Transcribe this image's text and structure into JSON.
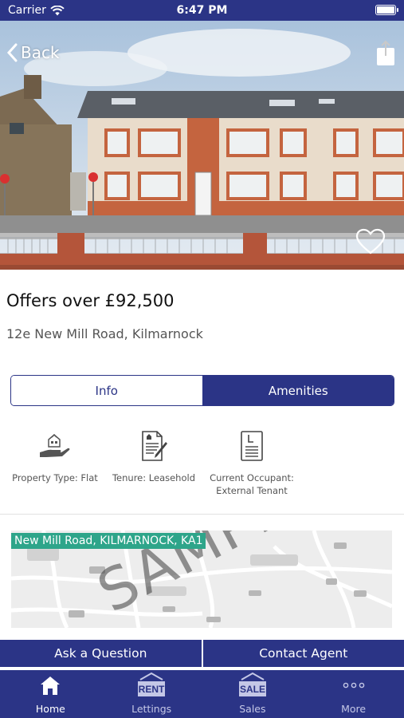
{
  "status_bar": {
    "carrier": "Carrier",
    "time": "6:47 PM",
    "icons": [
      "wifi-icon",
      "battery-icon"
    ]
  },
  "header": {
    "back_label": "Back",
    "icons": [
      "chevron-left-icon",
      "share-icon",
      "heart-icon"
    ]
  },
  "listing": {
    "price": "Offers over £92,500",
    "address": "12e New Mill Road, Kilmarnock"
  },
  "tabs": [
    {
      "label": "Info",
      "selected": false
    },
    {
      "label": "Amenities",
      "selected": true
    }
  ],
  "amenities": [
    {
      "icon": "house-hand-icon",
      "label": "Property Type: Flat"
    },
    {
      "icon": "contract-pen-icon",
      "label": "Tenure: Leasehold"
    },
    {
      "icon": "document-l-icon",
      "label": "Current Occupant: External Tenant"
    }
  ],
  "map": {
    "label": "New Mill Road, KILMARNOCK, KA1",
    "watermark": "SAMPLE"
  },
  "actions": {
    "ask_label": "Ask a Question",
    "contact_label": "Contact Agent"
  },
  "tabbar": [
    {
      "label": "Home",
      "icon": "home-icon",
      "active": true
    },
    {
      "label": "Lettings",
      "icon": "rent-sign-icon",
      "sign_text": "RENT",
      "active": false
    },
    {
      "label": "Sales",
      "icon": "sale-sign-icon",
      "sign_text": "SALE",
      "active": false
    },
    {
      "label": "More",
      "icon": "more-dots-icon",
      "active": false
    }
  ],
  "colors": {
    "brand": "#2b3486",
    "map_label": "#2ea58a",
    "brick": "#c4643f"
  }
}
